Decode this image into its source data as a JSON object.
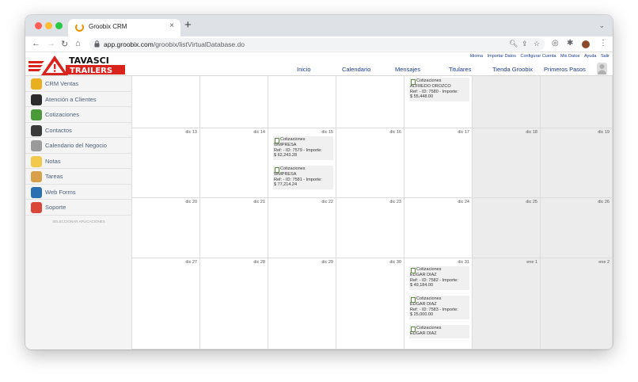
{
  "browser": {
    "tab_title": "Groobix CRM",
    "tab_close": "×",
    "new_tab": "+",
    "tabs_menu": "⌄",
    "url_host": "app.groobix.com",
    "url_path": "/groobix/listVirtualDatabase.do"
  },
  "header": {
    "logo_line1": "TAVASCI",
    "logo_line2": "TRAILERS",
    "top_links": [
      "Idioma",
      "Importar Datos",
      "Configurar Cuenta",
      "Mis Datos",
      "Ayuda",
      "Salir"
    ],
    "nav": [
      "Inicio",
      "Calendario",
      "Mensajes",
      "Titulares",
      "Tienda Groobix",
      "Primeros Pasos"
    ]
  },
  "sidebar": {
    "items": [
      {
        "label": "CRM Ventas",
        "color": "#e8b020"
      },
      {
        "label": "Atención a Clientes",
        "color": "#2b2b2b"
      },
      {
        "label": "Cotizaciones",
        "color": "#4a9a3a"
      },
      {
        "label": "Contactos",
        "color": "#3a3a3a"
      },
      {
        "label": "Calendario del Negocio",
        "color": "#9a9a9a"
      },
      {
        "label": "Notas",
        "color": "#f2c94c"
      },
      {
        "label": "Tareas",
        "color": "#d9a04a"
      },
      {
        "label": "Web Forms",
        "color": "#2a6fb0"
      },
      {
        "label": "Soporte",
        "color": "#d9463a"
      }
    ],
    "footer": "SELECCIONAR APLICACIONES"
  },
  "calendar": {
    "weeks": [
      {
        "days": [
          "",
          "",
          "",
          "",
          "",
          "",
          ""
        ]
      },
      {
        "days": [
          "dic 13",
          "dic 14",
          "dic 15",
          "dic 16",
          "dic 17",
          "dic 18",
          "dic 19"
        ]
      },
      {
        "days": [
          "dic 20",
          "dic 21",
          "dic 22",
          "dic 23",
          "dic 24",
          "dic 25",
          "dic 26"
        ]
      },
      {
        "days": [
          "dic 27",
          "dic 28",
          "dic 29",
          "dic 30",
          "dic 31",
          "ene 1",
          "ene 2"
        ]
      }
    ],
    "events": [
      {
        "week": 0,
        "day": 4,
        "title": "Cotizaciones",
        "name": "ALFREDO OROZCO",
        "ref": "Ref: - ID: 7580 - Importe:",
        "amount": "$ 55,448.00"
      },
      {
        "week": 1,
        "day": 2,
        "title": "Cotizaciones",
        "name": "WMPRESA",
        "ref": "Ref: - ID: 7579 - Importe:",
        "amount": "$ 62,243.28"
      },
      {
        "week": 1,
        "day": 2,
        "title": "Cotizaciones",
        "name": "WMPRESA",
        "ref": "Ref: - ID: 7581 - Importe:",
        "amount": "$ 77,214.24"
      },
      {
        "week": 3,
        "day": 4,
        "title": "Cotizaciones",
        "name": "EDGAR DIAZ",
        "ref": "Ref: - ID: 7582 - Importe:",
        "amount": "$ 49,184.00"
      },
      {
        "week": 3,
        "day": 4,
        "title": "Cotizaciones",
        "name": "EDGAR DIAZ",
        "ref": "Ref: - ID: 7583 - Importe:",
        "amount": "$ 25,000.00"
      },
      {
        "week": 3,
        "day": 4,
        "title": "Cotizaciones",
        "name": "EDGAR DIAZ",
        "ref": "",
        "amount": ""
      }
    ]
  }
}
